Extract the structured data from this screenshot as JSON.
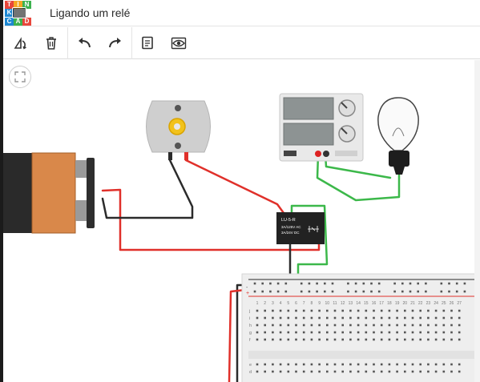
{
  "app": {
    "title": "Ligando um relé",
    "logo_letters": [
      "T",
      "I",
      "N",
      "K",
      "C",
      "A",
      "D"
    ]
  },
  "toolbar": {
    "buttons": [
      {
        "name": "rotate-icon"
      },
      {
        "name": "trash-icon"
      },
      {
        "name": "undo-icon"
      },
      {
        "name": "redo-icon"
      },
      {
        "name": "notes-icon"
      },
      {
        "name": "visibility-icon"
      }
    ]
  },
  "components": {
    "relay": {
      "line1": "LU-5-R",
      "line2": "3A/125V AC",
      "line3": "3A/24V DC"
    },
    "breadboard": {
      "column_numbers": [
        "1",
        "2",
        "3",
        "4",
        "5",
        "6",
        "7",
        "8",
        "9",
        "10",
        "11",
        "12",
        "13",
        "14",
        "15",
        "16",
        "17",
        "18",
        "19",
        "20",
        "21",
        "22",
        "23",
        "24",
        "25",
        "26",
        "27"
      ],
      "row_letters_top": [
        "j",
        "i",
        "h",
        "g",
        "f"
      ],
      "row_letters_bottom": [
        "e",
        "d"
      ],
      "rail_plus": "+",
      "rail_minus": "-"
    }
  },
  "colors": {
    "wire_red": "#e0302a",
    "wire_black": "#2b2b2b",
    "wire_green": "#3cb84a",
    "battery_orange": "#d9884a",
    "relay_body": "#222222",
    "breadboard": "#eeeeee"
  }
}
